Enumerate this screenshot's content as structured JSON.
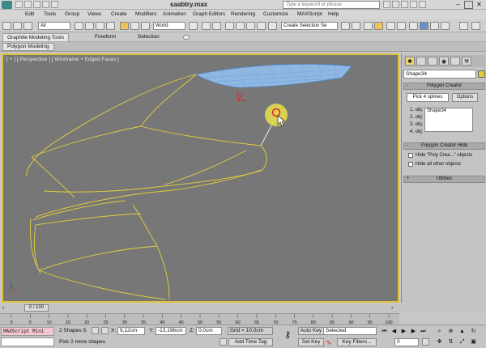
{
  "window": {
    "title": "saabtry.max",
    "search_placeholder": "Type a keyword or phrase"
  },
  "menu": [
    "Edit",
    "Tools",
    "Group",
    "Views",
    "Create",
    "Modifiers",
    "Animation",
    "Graph Editors",
    "Rendering",
    "Customize",
    "MAXScript",
    "Help"
  ],
  "toolbar": {
    "selection_filter": "All",
    "reference_coord": "World",
    "named_selection_placeholder": "Create Selection Se"
  },
  "ribbon": {
    "tabs": [
      "Graphite Modeling Tools",
      "Freeform",
      "Selection"
    ],
    "subtab": "Polygon Modeling"
  },
  "viewport": {
    "label": "[ + ] [ Perspective ] [ Wireframe + Edged Faces ]"
  },
  "command_panel": {
    "object_name": "Shape34",
    "rollout_creator": "Polygon Creator",
    "pick_button": "Pick 4 splines",
    "options_button": "Options",
    "obj_labels": [
      "1. obj:",
      "2. obj:",
      "3. obj:",
      "4. obj:"
    ],
    "picked_objects": [
      "Shape34"
    ],
    "rollout_hide": "Polygon Creator Hide",
    "hide_options": [
      "Hide \"Poly Crea...\" objects",
      "Hide all other objects"
    ],
    "rollout_utilities": "Utilities"
  },
  "timeline": {
    "frame_display": "0 / 100",
    "ticks": [
      "0",
      "5",
      "10",
      "15",
      "20",
      "25",
      "30",
      "35",
      "40",
      "45",
      "50",
      "55",
      "60",
      "65",
      "70",
      "75",
      "80",
      "85",
      "90",
      "95",
      "100"
    ]
  },
  "status": {
    "maxscript_label": "MAXScript Mini",
    "selection_info": "2 Shapes S",
    "prompt": "Pick 2 more shapes",
    "x_label": "X:",
    "x_value": "9,12cm",
    "y_label": "Y:",
    "y_value": "-13,196cm",
    "z_label": "Z:",
    "z_value": "0,0cm",
    "grid": "Grid = 10,0cm",
    "add_time_tag": "Add Time Tag",
    "auto_key": "Auto Key",
    "set_key": "Set Key",
    "key_mode": "Selected",
    "key_filters": "Key Filters...",
    "current_frame": "0"
  }
}
